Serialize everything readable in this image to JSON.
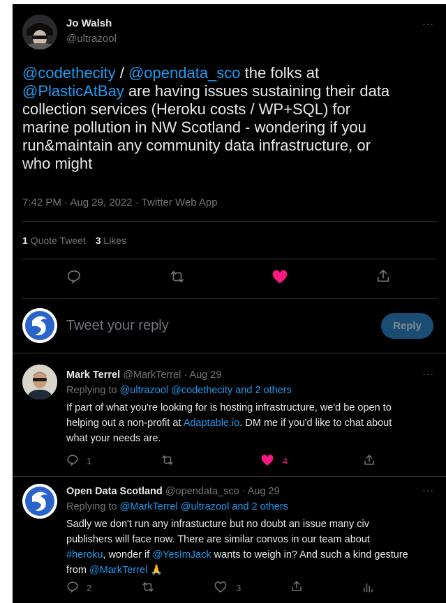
{
  "author": {
    "name": "Jo Walsh",
    "handle": "@ultrazool"
  },
  "tweet": {
    "mention1": "@codethecity",
    "slash": " / ",
    "mention2": "@opendata_sco",
    "text1": " the folks at",
    "mention3": "@PlasticAtBay",
    "text2": " are having issues sustaining their data",
    "line3": "collection services (Heroku costs / WP+SQL) for",
    "line4": "marine pollution in NW Scotland - wondering if you",
    "line5": "run&maintain any community data infrastructure, or",
    "line6": "who might"
  },
  "meta": {
    "timestamp": "7:42 PM · Aug 29, 2022 · Twitter Web App"
  },
  "stats": {
    "quote_count": "1",
    "quote_label": "Quote Tweet",
    "likes_count": "3",
    "likes_label": "Likes"
  },
  "compose": {
    "placeholder": "Tweet your reply",
    "reply_label": "Reply"
  },
  "replies": [
    {
      "name": "Mark Terrel",
      "handle": "@MarkTerrel",
      "date": "· Aug 29",
      "replying_prefix": "Replying to",
      "replying_users": "@ultrazool @codethecity and 2 others",
      "line1": "If part of what you're looking for is hosting infrastructure, we'd be open to",
      "line2_pre": "helping out a non-profit at ",
      "line2_link": "Adaptable.io",
      "line2_post": ". DM me if you'd like to chat about",
      "line3": "what your needs are.",
      "reply_count": "1",
      "like_count": "4"
    },
    {
      "name": "Open Data Scotland",
      "handle": "@opendata_sco",
      "date": "· Aug 29",
      "replying_prefix": "Replying to",
      "replying_users": "@MarkTerrel @ultrazool and 2 others",
      "line1": "Sadly we don't run any infrastucture but no doubt an issue many civ",
      "line2": "publishers will face now. There are similar convos in our team about",
      "line3_tag": "#heroku",
      "line3_mid": ", wonder if ",
      "line3_mention": "@YesImJack",
      "line3_post": " wants to weigh in? And such a kind gesture",
      "line4_pre": "from ",
      "line4_mention": "@MarkTerrel",
      "line4_emoji": "🙏",
      "reply_count": "2",
      "like_count": "3"
    }
  ],
  "icons": {
    "reply": "reply-icon",
    "retweet": "retweet-icon",
    "like": "heart-icon",
    "share": "share-icon",
    "analytics": "analytics-icon",
    "more": "more-icon"
  },
  "colors": {
    "background": "#000000",
    "accent": "#1d9bf0",
    "like": "#f91880",
    "muted": "#71767b",
    "text": "#e7e9ea"
  }
}
